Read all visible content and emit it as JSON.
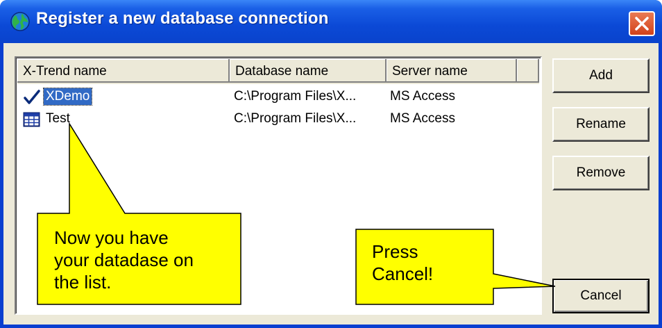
{
  "window": {
    "title": "Register a new database connection"
  },
  "list": {
    "columns": [
      "X-Trend name",
      "Database name",
      "Server name",
      ""
    ],
    "rows": [
      {
        "name": "XDemo",
        "database": "C:\\Program Files\\X...",
        "server": "MS Access",
        "icon": "checkmark-icon",
        "selected": true
      },
      {
        "name": "Test",
        "database": "C:\\Program Files\\X...",
        "server": "MS Access",
        "icon": "table-icon",
        "selected": false
      }
    ]
  },
  "buttons": {
    "add": "Add",
    "rename": "Rename",
    "remove": "Remove",
    "cancel": "Cancel"
  },
  "callouts": {
    "left": [
      "Now you have",
      "your datadase on",
      "the list."
    ],
    "right": [
      "Press",
      "Cancel!"
    ]
  },
  "colors": {
    "titlebar": "#0a43cc",
    "selection": "#316ac5",
    "callout_fill": "#ffff00",
    "close_button": "#d3421a"
  }
}
